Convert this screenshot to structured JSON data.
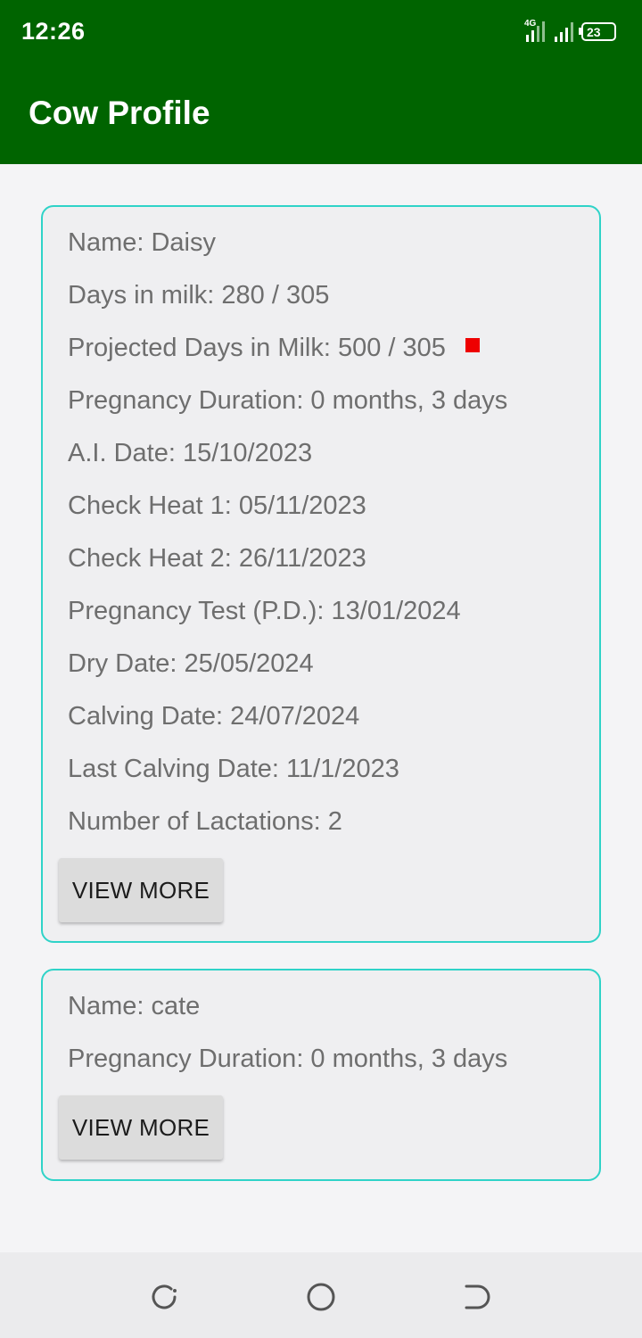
{
  "status_bar": {
    "time": "12:26",
    "network": "4G",
    "battery": "23"
  },
  "app_bar": {
    "title": "Cow Profile"
  },
  "cows": [
    {
      "name": "Name: Daisy",
      "days_in_milk": "Days in milk: 280 / 305",
      "projected_days_in_milk": "Projected Days in Milk: 500 / 305",
      "projected_status_color": "#ee0000",
      "pregnancy_duration": "Pregnancy Duration: 0 months, 3 days",
      "ai_date": "A.I. Date: 15/10/2023",
      "check_heat_1": "Check Heat 1: 05/11/2023",
      "check_heat_2": "Check Heat 2: 26/11/2023",
      "pregnancy_test": "Pregnancy Test (P.D.): 13/01/2024",
      "dry_date": "Dry Date: 25/05/2024",
      "calving_date": "Calving Date: 24/07/2024",
      "last_calving_date": "Last Calving Date: 11/1/2023",
      "lactations": "Number of Lactations: 2",
      "view_more_label": "VIEW MORE"
    },
    {
      "name": "Name: cate",
      "pregnancy_duration": "Pregnancy Duration: 0 months, 3 days",
      "view_more_label": "VIEW MORE"
    }
  ],
  "navigation": {
    "recents_icon": "recents-icon",
    "home_icon": "home-icon",
    "back_icon": "back-icon"
  },
  "colors": {
    "primary": "#006400",
    "card_border": "#2fd3c8"
  }
}
